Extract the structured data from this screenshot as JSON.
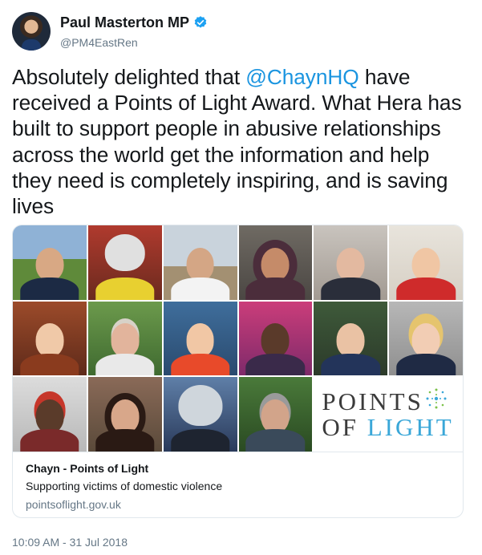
{
  "author": {
    "name": "Paul Masterton MP",
    "handle": "@PM4EastRen",
    "verified": true
  },
  "tweet": {
    "text_before": "Absolutely delighted that ",
    "mention": "@ChaynHQ",
    "text_after": " have received a Points of Light Award. What Hera has built to support people in abusive relationships across the world get the information and help they need is completely inspiring, and is saving lives"
  },
  "card": {
    "logo_line1": "POINTS",
    "logo_line2_a": "OF ",
    "logo_line2_b": "LIGHT",
    "title": "Chayn - Points of Light",
    "description": "Supporting victims of domestic violence",
    "domain": "pointsoflight.gov.uk"
  },
  "timestamp": "10:09 AM - 31 Jul 2018",
  "colors": {
    "link": "#1b95e0",
    "muted": "#657786",
    "border": "#e1e8ed"
  },
  "icons": [
    "verified-badge-icon",
    "points-of-light-logo-icon"
  ]
}
